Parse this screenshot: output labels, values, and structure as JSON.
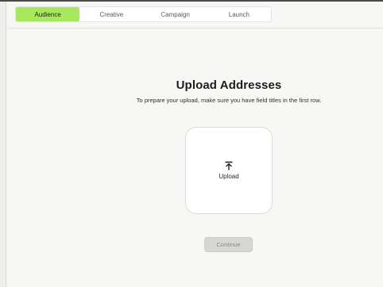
{
  "stepper": {
    "steps": [
      {
        "label": "Audience",
        "active": true
      },
      {
        "label": "Creative",
        "active": false
      },
      {
        "label": "Campaign",
        "active": false
      },
      {
        "label": "Launch",
        "active": false
      }
    ],
    "active_color": "#a8e85c"
  },
  "main": {
    "title": "Upload Addresses",
    "subtitle": "To prepare your upload, make sure you have field titles in the first row.",
    "upload": {
      "icon": "upload-arrow-icon",
      "label": "Upload"
    },
    "continue_label": "Continue",
    "continue_disabled": true
  }
}
